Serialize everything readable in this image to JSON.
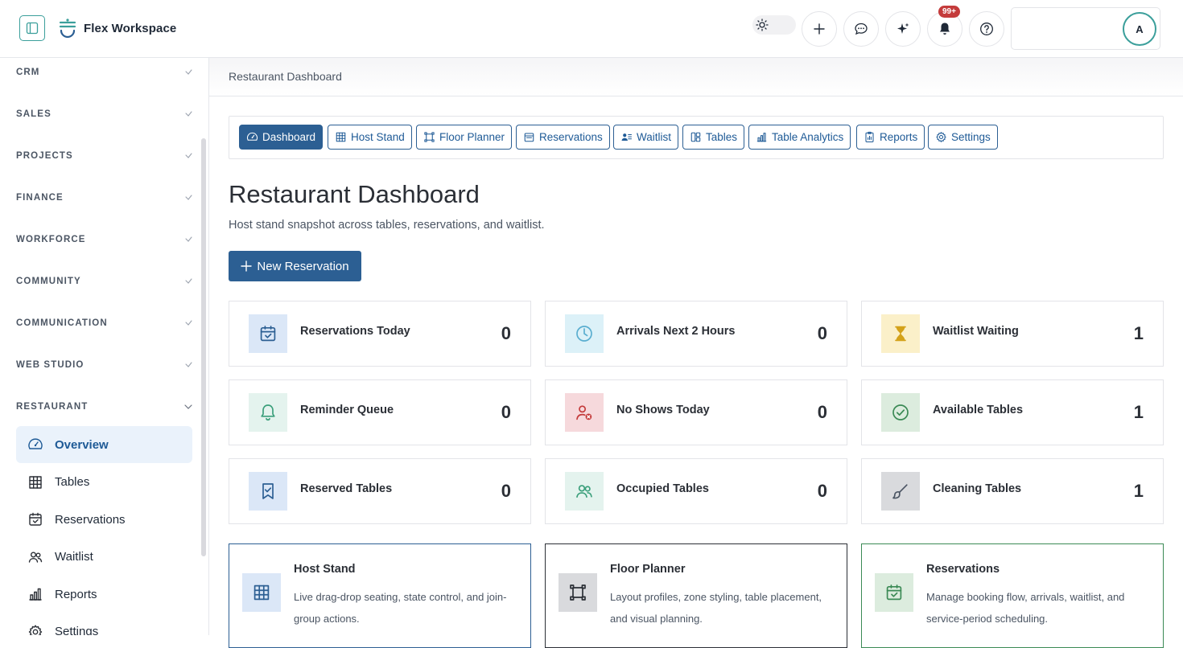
{
  "app": {
    "name": "Flex Workspace"
  },
  "topbar": {
    "notification_count": "99+",
    "avatar_initial": "A"
  },
  "sidebar": {
    "sections": [
      "CRM",
      "SALES",
      "PROJECTS",
      "FINANCE",
      "WORKFORCE",
      "COMMUNITY",
      "COMMUNICATION",
      "WEB STUDIO",
      "RESTAURANT"
    ],
    "restaurant_items": [
      {
        "label": "Overview",
        "icon": "gauge-icon",
        "active": true
      },
      {
        "label": "Tables",
        "icon": "grid-icon",
        "active": false
      },
      {
        "label": "Reservations",
        "icon": "calendar-check-icon",
        "active": false
      },
      {
        "label": "Waitlist",
        "icon": "users-icon",
        "active": false
      },
      {
        "label": "Reports",
        "icon": "bar-chart-icon",
        "active": false
      },
      {
        "label": "Settings",
        "icon": "gear-icon",
        "active": false
      }
    ]
  },
  "breadcrumb": "Restaurant Dashboard",
  "tabs": [
    {
      "label": "Dashboard",
      "icon": "gauge-icon",
      "active": true
    },
    {
      "label": "Host Stand",
      "icon": "grid-icon",
      "active": false
    },
    {
      "label": "Floor Planner",
      "icon": "frame-icon",
      "active": false
    },
    {
      "label": "Reservations",
      "icon": "calendar-icon",
      "active": false
    },
    {
      "label": "Waitlist",
      "icon": "user-list-icon",
      "active": false
    },
    {
      "label": "Tables",
      "icon": "layout-icon",
      "active": false
    },
    {
      "label": "Table Analytics",
      "icon": "bar-chart-icon",
      "active": false
    },
    {
      "label": "Reports",
      "icon": "report-icon",
      "active": false
    },
    {
      "label": "Settings",
      "icon": "gear-icon",
      "active": false
    }
  ],
  "page": {
    "title": "Restaurant Dashboard",
    "subtitle": "Host stand snapshot across tables, reservations, and waitlist.",
    "new_button": "New Reservation"
  },
  "stats": [
    {
      "label": "Reservations Today",
      "value": "0",
      "icon": "calendar-check-icon",
      "bg": "#dbe7f7",
      "color": "#2c5f93"
    },
    {
      "label": "Arrivals Next 2 Hours",
      "value": "0",
      "icon": "clock-icon",
      "bg": "#dcf1f8",
      "color": "#5aaed0"
    },
    {
      "label": "Waitlist Waiting",
      "value": "1",
      "icon": "hourglass-icon",
      "bg": "#fbf0c9",
      "color": "#d4a21a"
    },
    {
      "label": "Reminder Queue",
      "value": "0",
      "icon": "bell-icon",
      "bg": "#e4f3ee",
      "color": "#3b9f7b"
    },
    {
      "label": "No Shows Today",
      "value": "0",
      "icon": "user-x-icon",
      "bg": "#f6d9dc",
      "color": "#c43b3b"
    },
    {
      "label": "Available Tables",
      "value": "1",
      "icon": "check-circle-icon",
      "bg": "#dcecde",
      "color": "#3b8a55"
    },
    {
      "label": "Reserved Tables",
      "value": "0",
      "icon": "bookmark-check-icon",
      "bg": "#dbe7f7",
      "color": "#2c5f93"
    },
    {
      "label": "Occupied Tables",
      "value": "0",
      "icon": "users-icon",
      "bg": "#e4f3ee",
      "color": "#3b9f7b"
    },
    {
      "label": "Cleaning Tables",
      "value": "1",
      "icon": "brush-icon",
      "bg": "#d9dadd",
      "color": "#4b5563"
    }
  ],
  "modules": [
    {
      "title": "Host Stand",
      "desc": "Live drag-drop seating, state control, and join-group actions.",
      "icon": "grid-icon",
      "bg": "#dbe7f7",
      "color": "#2c5f93",
      "border": "#2c5f93"
    },
    {
      "title": "Floor Planner",
      "desc": "Layout profiles, zone styling, table placement, and visual planning.",
      "icon": "frame-icon",
      "bg": "#d9dadd",
      "color": "#2b2f36",
      "border": "#2b2f36"
    },
    {
      "title": "Reservations",
      "desc": "Manage booking flow, arrivals, waitlist, and service-period scheduling.",
      "icon": "calendar-check-icon",
      "bg": "#dcecde",
      "color": "#3b8a55",
      "border": "#3b8a55"
    }
  ]
}
